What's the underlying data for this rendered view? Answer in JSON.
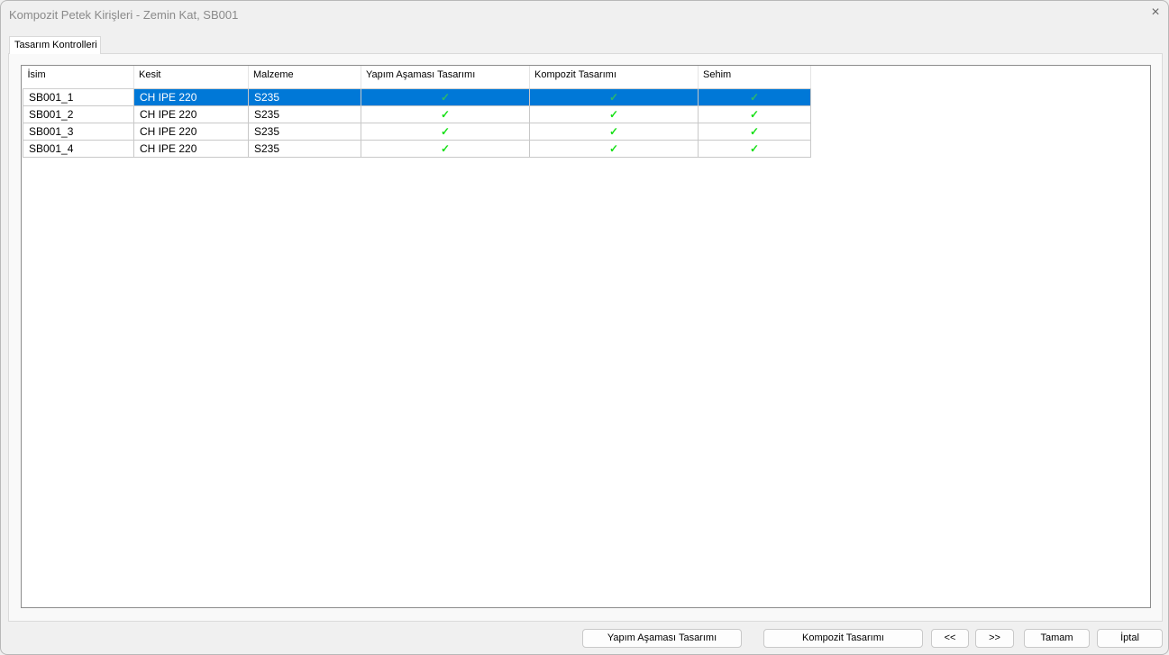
{
  "window": {
    "title": "Kompozit Petek Kirişleri - Zemin Kat, SB001",
    "close_icon": "×"
  },
  "tabs": [
    {
      "label": "Tasarım Kontrolleri"
    }
  ],
  "table": {
    "columns": [
      "İsim",
      "Kesit",
      "Malzeme",
      "Yapım Aşaması Tasarımı",
      "Kompozit Tasarımı",
      "Sehim"
    ],
    "check_glyph": "✓",
    "rows": [
      {
        "name": "SB001_1",
        "section": "CH IPE 220",
        "material": "S235",
        "construction": true,
        "composite": true,
        "deflection": true,
        "selected": true
      },
      {
        "name": "SB001_2",
        "section": "CH IPE 220",
        "material": "S235",
        "construction": true,
        "composite": true,
        "deflection": true
      },
      {
        "name": "SB001_3",
        "section": "CH IPE 220",
        "material": "S235",
        "construction": true,
        "composite": true,
        "deflection": true
      },
      {
        "name": "SB001_4",
        "section": "CH IPE 220",
        "material": "S235",
        "construction": true,
        "composite": true,
        "deflection": true
      }
    ]
  },
  "buttons": {
    "construction": "Yapım Aşaması Tasarımı",
    "composite": "Kompozit Tasarımı",
    "prev": "<<",
    "next": ">>",
    "ok": "Tamam",
    "cancel": "İptal"
  },
  "colors": {
    "selection": "#0078d7",
    "check": "#16e016"
  }
}
